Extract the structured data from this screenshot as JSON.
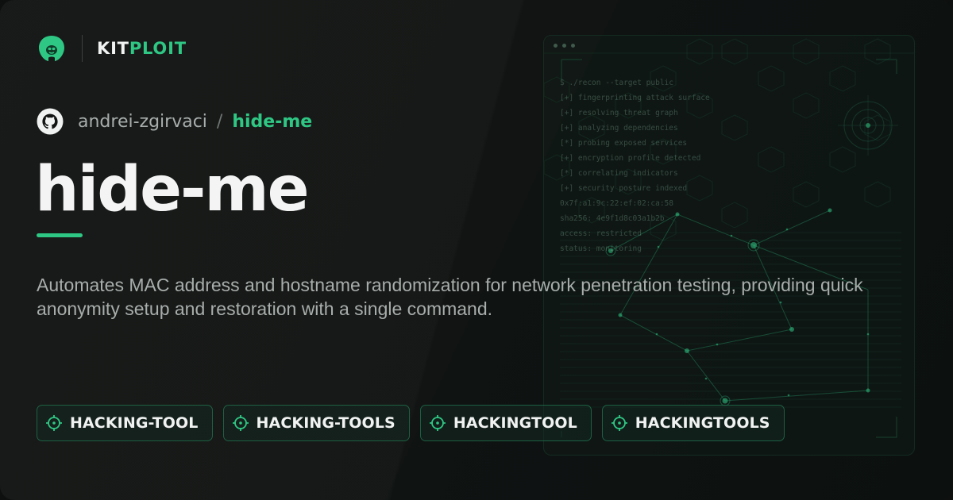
{
  "brand": {
    "name_part1": "KIT",
    "name_part2": "PLOIT",
    "logo_icon": "alien-head-logo",
    "accent_color": "#2fc784"
  },
  "repo": {
    "icon": "github-icon",
    "owner": "andrei-zgirvaci",
    "separator": "/",
    "name": "hide-me"
  },
  "title": "hide-me",
  "description": "Automates MAC address and hostname randomization for network penetration testing, providing quick anonymity setup and restoration with a single command.",
  "terminal": {
    "lines": [
      "$ ./recon --target public",
      "[+] fingerprinting attack surface",
      "[+] resolving threat graph",
      "[+] analyzing dependencies",
      "[*] probing exposed services",
      "[+] encryption profile detected",
      "[*] correlating indicators",
      "[+] security posture indexed",
      "0x7f:a1:9c:22:ef:02:ca:58",
      "sha256: 4e9f1d8c03a1b2b",
      "access: restricted",
      "status: monitoring"
    ]
  },
  "tags": [
    {
      "label": "HACKING-TOOL",
      "icon": "crosshair-icon"
    },
    {
      "label": "HACKING-TOOLS",
      "icon": "crosshair-icon"
    },
    {
      "label": "HACKINGTOOL",
      "icon": "crosshair-icon"
    },
    {
      "label": "HACKINGTOOLS",
      "icon": "crosshair-icon"
    }
  ],
  "colors": {
    "background": "#121413",
    "accent": "#2fc784",
    "text_primary": "#f3f4f3",
    "text_secondary": "#a8aeab"
  }
}
